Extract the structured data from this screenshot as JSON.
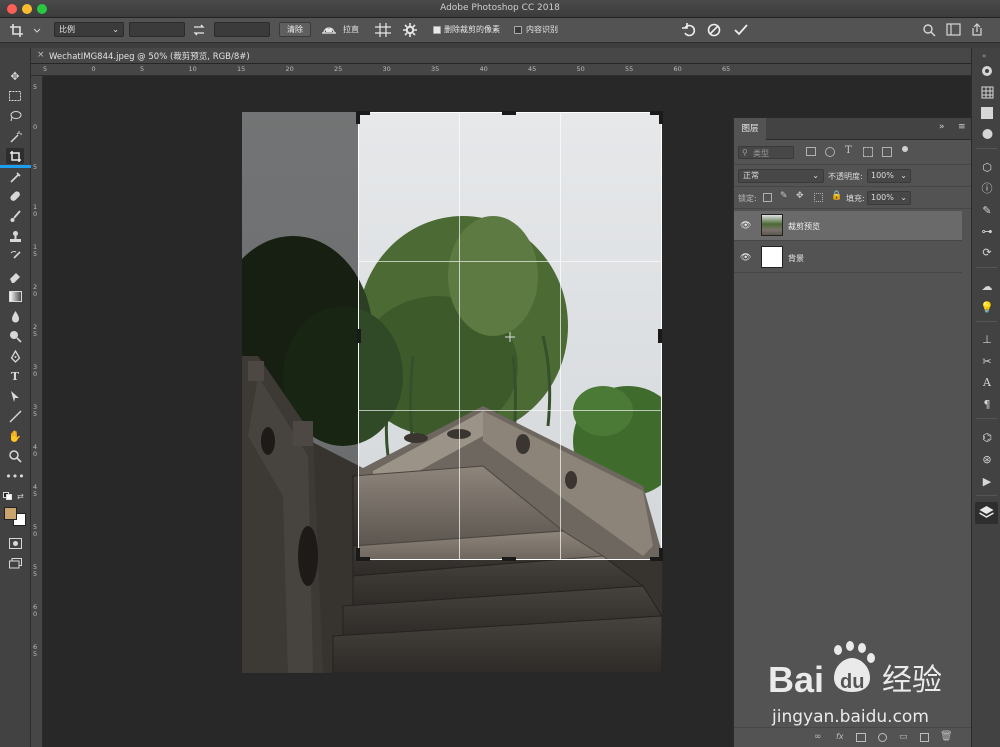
{
  "window": {
    "title": "Adobe Photoshop CC 2018"
  },
  "options": {
    "ratio_select": "比例",
    "clear_label": "清除",
    "straighten_label": "拉直",
    "delete_cropped_label": "删除裁剪的像素",
    "content_aware_label": "内容识别"
  },
  "document": {
    "tab_label": "WechatIMG844.jpeg @ 50% (裁剪预览, RGB/8#)"
  },
  "ruler": {
    "top_labels": [
      "5",
      "0",
      "5",
      "10",
      "15",
      "20",
      "25",
      "30",
      "35",
      "40",
      "45",
      "50",
      "55",
      "60",
      "65"
    ],
    "left_labels": [
      "5",
      "0",
      "5",
      "1 0",
      "1 5",
      "2 0",
      "2 5",
      "3 0",
      "3 5",
      "4 0",
      "4 5",
      "5 0",
      "5 5",
      "6 0",
      "6 5"
    ]
  },
  "layers_panel": {
    "tab_label": "图层",
    "filter_placeholder": "类型",
    "blend_mode": "正常",
    "opacity_label": "不透明度:",
    "opacity_value": "100%",
    "lock_label": "锁定:",
    "fill_label": "填充:",
    "fill_value": "100%",
    "layers": [
      {
        "name": "裁剪预览",
        "selected": true
      },
      {
        "name": "背景",
        "selected": false
      }
    ]
  },
  "watermark": {
    "brand_bai": "Bai",
    "brand_du": "du",
    "brand_cn": "经验",
    "url": "jingyan.baidu.com"
  },
  "colors": {
    "accent": "#1c9ff0",
    "foreground_swatch": "#c9a46c",
    "background_swatch": "#ffffff"
  }
}
